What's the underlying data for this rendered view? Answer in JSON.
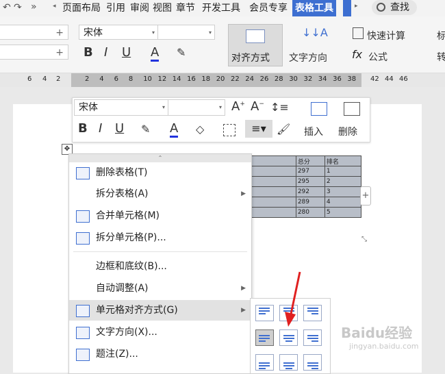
{
  "tabbar": {
    "tabs": [
      "页面布局",
      "引用",
      "审阅",
      "视图",
      "章节",
      "开发工具",
      "会员专享",
      "表格工具"
    ],
    "active_tab": "表格工具",
    "search_label": "查找"
  },
  "ribbon": {
    "font_name": "宋体",
    "align_button": "对齐方式",
    "text_direction": "文字方向",
    "quick_calc": "快速计算",
    "formula": "公式",
    "cut_label_1": "标",
    "cut_label_2": "转"
  },
  "ruler": {
    "left_ticks": [
      "6",
      "4",
      "2"
    ],
    "mid_ticks": [
      "2",
      "4",
      "6",
      "8",
      "10",
      "12",
      "14",
      "16",
      "18",
      "20",
      "22",
      "24",
      "26",
      "28",
      "30",
      "32",
      "34",
      "36",
      "38"
    ],
    "right_ticks": [
      "42",
      "44",
      "46"
    ]
  },
  "float_toolbar": {
    "font_name": "宋体",
    "insert_label": "插入",
    "delete_label": "删除"
  },
  "table": {
    "header": [
      "总分",
      "排名"
    ],
    "rows": [
      [
        "297",
        "1"
      ],
      [
        "295",
        "2"
      ],
      [
        "292",
        "3"
      ],
      [
        "289",
        "4"
      ],
      [
        "280",
        "5"
      ]
    ]
  },
  "context_menu": {
    "items": [
      {
        "label": "删除表格(T)",
        "icon": "delete-table-icon"
      },
      {
        "label": "拆分表格(A)",
        "icon": ""
      },
      {
        "label": "合并单元格(M)",
        "icon": "merge-cells-icon"
      },
      {
        "label": "拆分单元格(P)...",
        "icon": "split-cells-icon"
      },
      {
        "label": "边框和底纹(B)...",
        "icon": ""
      },
      {
        "label": "自动调整(A)",
        "icon": ""
      },
      {
        "label": "单元格对齐方式(G)",
        "icon": "cell-align-icon"
      },
      {
        "label": "文字方向(X)...",
        "icon": "text-direction-icon"
      },
      {
        "label": "题注(Z)...",
        "icon": "caption-icon"
      }
    ]
  },
  "watermark": {
    "text": "Baidu经验",
    "url": "jingyan.baidu.com"
  },
  "colors": {
    "accent": "#3d6fd1",
    "arrow": "#e02020",
    "table_fill": "#b8bec8"
  }
}
